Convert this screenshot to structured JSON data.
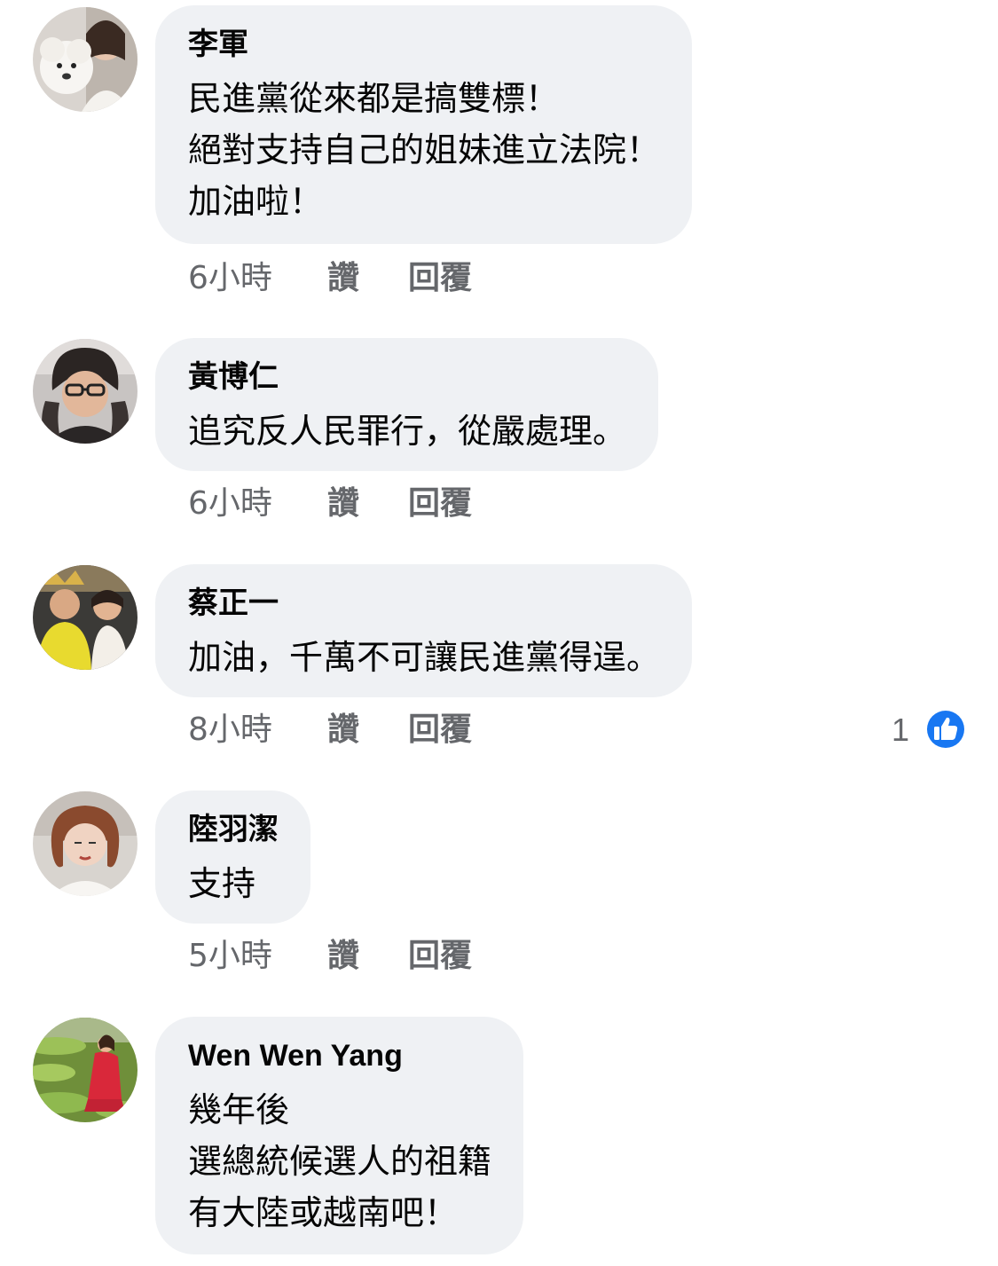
{
  "comments": [
    {
      "author": "李軍",
      "lines": [
        "民進黨從來都是搞雙標！",
        "絕對支持自己的姐妹進立法院！",
        "加油啦！"
      ],
      "time": "6小時",
      "like_label": "讚",
      "reply_label": "回覆"
    },
    {
      "author": "黃博仁",
      "lines": [
        "追究反人民罪行，從嚴處理。"
      ],
      "time": "6小時",
      "like_label": "讚",
      "reply_label": "回覆"
    },
    {
      "author": "蔡正一",
      "lines": [
        "加油，千萬不可讓民進黨得逞。"
      ],
      "time": "8小時",
      "like_label": "讚",
      "reply_label": "回覆",
      "reaction_count": "1",
      "reaction_icon": "like-thumbs-up-icon"
    },
    {
      "author": "陸羽潔",
      "lines": [
        "支持"
      ],
      "time": "5小時",
      "like_label": "讚",
      "reply_label": "回覆"
    },
    {
      "author": "Wen Wen Yang",
      "lines": [
        "幾年後",
        "選總統候選人的祖籍",
        "有大陸或越南吧！"
      ]
    }
  ],
  "colors": {
    "bubble": "#eff1f4",
    "meta_text": "#65676b",
    "like_blue": "#1877f2"
  }
}
